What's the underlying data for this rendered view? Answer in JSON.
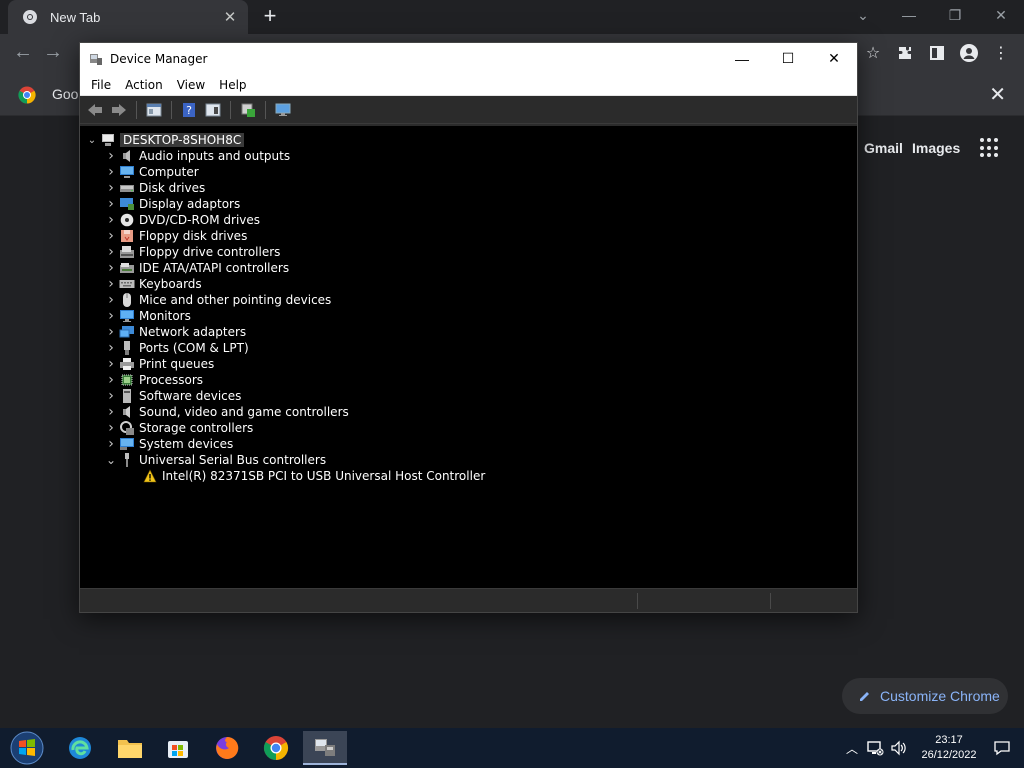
{
  "browser": {
    "tab_title": "New Tab",
    "infobar_text": "Goog",
    "ntp": {
      "gmail": "Gmail",
      "images": "Images",
      "customize": "Customize Chrome"
    }
  },
  "device_manager": {
    "title": "Device Manager",
    "menu": [
      "File",
      "Action",
      "View",
      "Help"
    ],
    "root": "DESKTOP-8SHOH8C",
    "categories": [
      {
        "label": "Audio inputs and outputs",
        "icon": "speaker-icon"
      },
      {
        "label": "Computer",
        "icon": "computer-icon"
      },
      {
        "label": "Disk drives",
        "icon": "disk-drive-icon"
      },
      {
        "label": "Display adaptors",
        "icon": "display-adapter-icon"
      },
      {
        "label": "DVD/CD-ROM drives",
        "icon": "dvd-icon"
      },
      {
        "label": "Floppy disk drives",
        "icon": "floppy-disk-icon"
      },
      {
        "label": "Floppy drive controllers",
        "icon": "floppy-controller-icon"
      },
      {
        "label": "IDE ATA/ATAPI controllers",
        "icon": "ide-controller-icon"
      },
      {
        "label": "Keyboards",
        "icon": "keyboard-icon"
      },
      {
        "label": "Mice and other pointing devices",
        "icon": "mouse-icon"
      },
      {
        "label": "Monitors",
        "icon": "monitor-icon"
      },
      {
        "label": "Network adapters",
        "icon": "network-adapter-icon"
      },
      {
        "label": "Ports (COM & LPT)",
        "icon": "port-icon"
      },
      {
        "label": "Print queues",
        "icon": "printer-icon"
      },
      {
        "label": "Processors",
        "icon": "processor-icon"
      },
      {
        "label": "Software devices",
        "icon": "software-device-icon"
      },
      {
        "label": "Sound, video and game controllers",
        "icon": "sound-controller-icon"
      },
      {
        "label": "Storage controllers",
        "icon": "storage-controller-icon"
      },
      {
        "label": "System devices",
        "icon": "system-device-icon"
      },
      {
        "label": "Universal Serial Bus controllers",
        "icon": "usb-icon"
      }
    ],
    "expanded_child": "Intel(R) 82371SB PCI to USB Universal Host Controller"
  },
  "taskbar": {
    "time": "23:17",
    "date": "26/12/2022"
  },
  "colors": {
    "accent_link": "#8ab4f8",
    "tree_background": "#000000",
    "warning": "#f0c419"
  }
}
